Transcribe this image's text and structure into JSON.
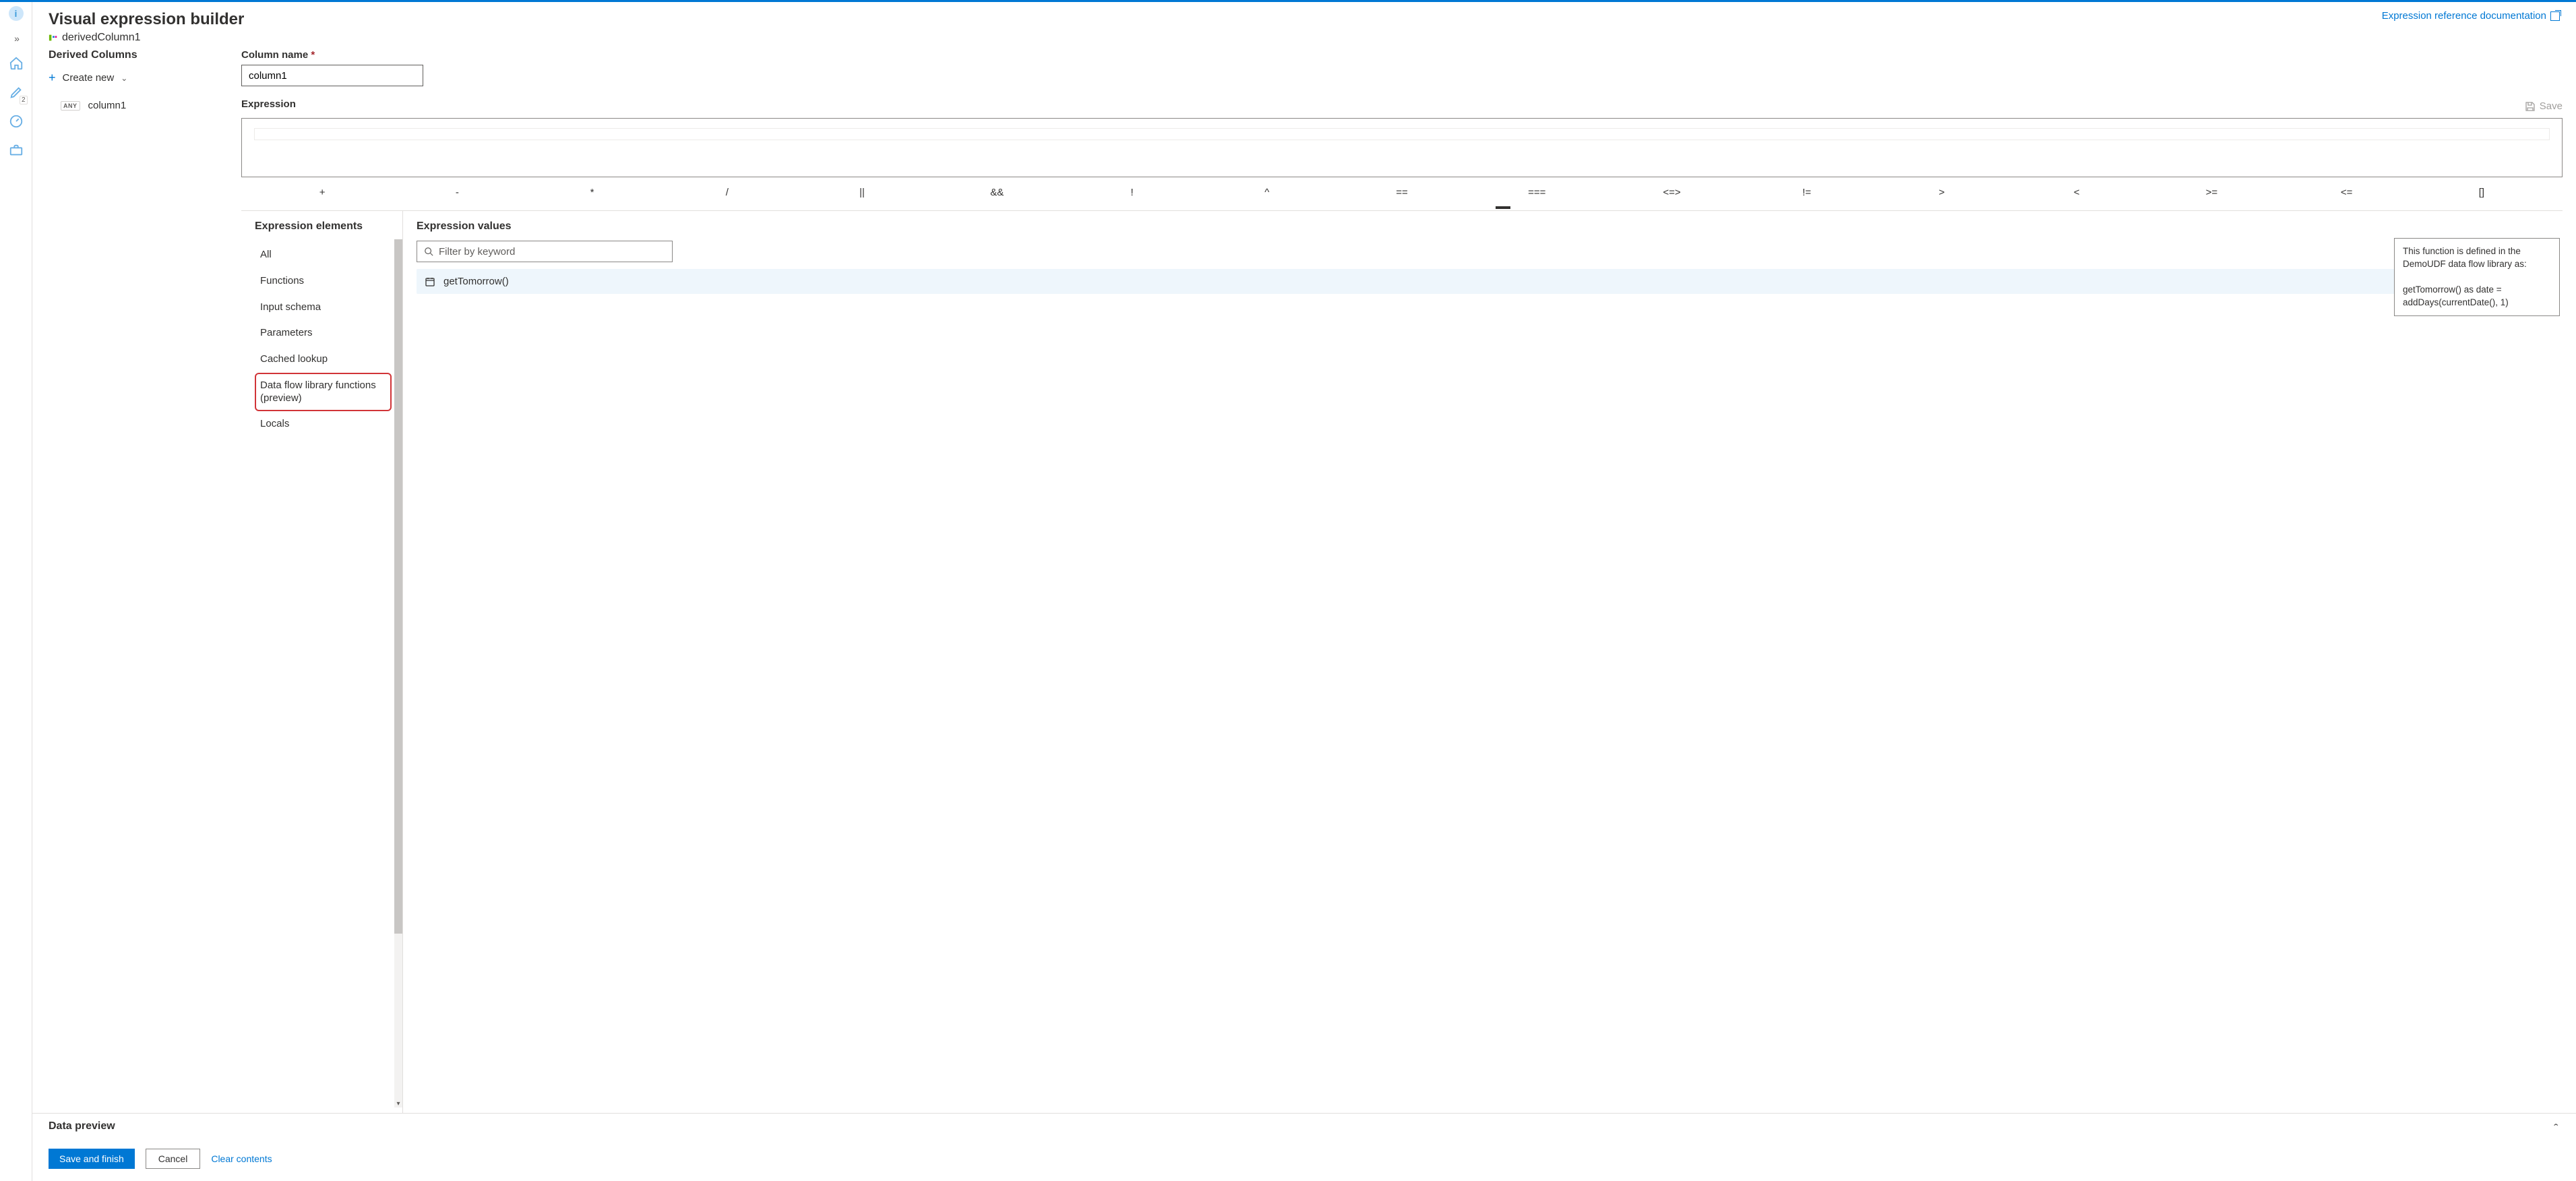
{
  "header": {
    "title": "Visual expression builder",
    "doc_link": "Expression reference documentation"
  },
  "node": {
    "name": "derivedColumn1"
  },
  "derived_columns": {
    "heading": "Derived Columns",
    "create_new": "Create new",
    "items": [
      {
        "type_chip": "ANY",
        "name": "column1"
      }
    ]
  },
  "column_name": {
    "label": "Column name",
    "value": "column1"
  },
  "expression": {
    "label": "Expression",
    "save_label": "Save"
  },
  "operators": [
    "+",
    "-",
    "*",
    "/",
    "||",
    "&&",
    "!",
    "^",
    "==",
    "===",
    "<=>",
    "!=",
    ">",
    "<",
    ">=",
    "<=",
    "[]"
  ],
  "elements": {
    "heading": "Expression elements",
    "items": [
      "All",
      "Functions",
      "Input schema",
      "Parameters",
      "Cached lookup",
      "Data flow library functions (preview)",
      "Locals"
    ],
    "highlighted_index": 5
  },
  "values": {
    "heading": "Expression values",
    "filter_placeholder": "Filter by keyword",
    "items": [
      {
        "icon": "calendar",
        "label": "getTomorrow()"
      }
    ]
  },
  "tooltip": "This function is defined in the DemoUDF data flow library as:\n\ngetTomorrow() as date = addDays(currentDate(), 1)",
  "preview": {
    "label": "Data preview"
  },
  "footer": {
    "save_finish": "Save and finish",
    "cancel": "Cancel",
    "clear": "Clear contents"
  }
}
